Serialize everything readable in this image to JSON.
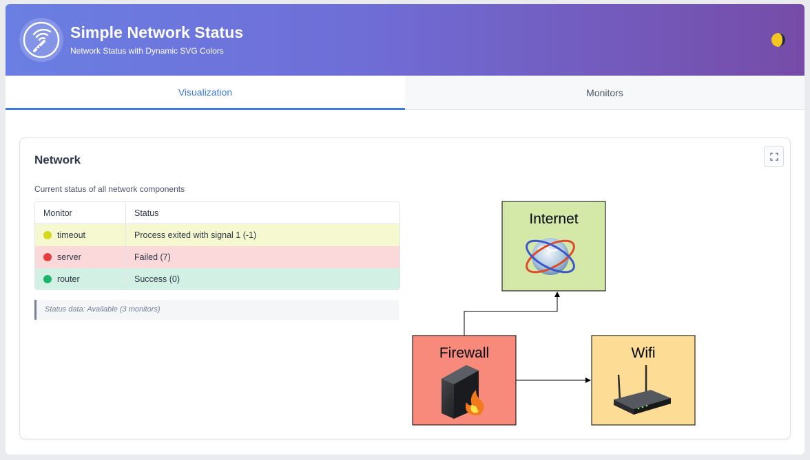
{
  "header": {
    "title": "Simple Network Status",
    "subtitle": "Network Status with Dynamic SVG Colors",
    "logo_icon": "wifi-logo-icon",
    "theme_icon": "theme-toggle-icon"
  },
  "tabs": [
    {
      "label": "Visualization",
      "active": true
    },
    {
      "label": "Monitors",
      "active": false
    }
  ],
  "card": {
    "title": "Network",
    "description": "Current status of all network components",
    "expand_icon": "expand-icon"
  },
  "table": {
    "columns": [
      "Monitor",
      "Status"
    ],
    "rows": [
      {
        "monitor": "timeout",
        "status": "Process exited with signal 1 (-1)",
        "dot_color": "#d4d71c",
        "bg_color": "#f6f9cf"
      },
      {
        "monitor": "server",
        "status": "Failed (7)",
        "dot_color": "#e53e3e",
        "bg_color": "#fbd9da"
      },
      {
        "monitor": "router",
        "status": "Success (0)",
        "dot_color": "#1db36b",
        "bg_color": "#d2f1e4"
      }
    ]
  },
  "status_note": "Status data: Available (3 monitors)",
  "diagram": {
    "nodes": [
      {
        "label": "Internet",
        "color": "#d4e8a8",
        "icon": "globe-icon"
      },
      {
        "label": "Firewall",
        "color": "#f88a7c",
        "icon": "firewall-icon"
      },
      {
        "label": "Wifi",
        "color": "#fddc95",
        "icon": "router-icon"
      }
    ]
  },
  "colors": {
    "accent": "#3b7be0",
    "header_start": "#6a7fe3",
    "header_end": "#764ca8"
  }
}
